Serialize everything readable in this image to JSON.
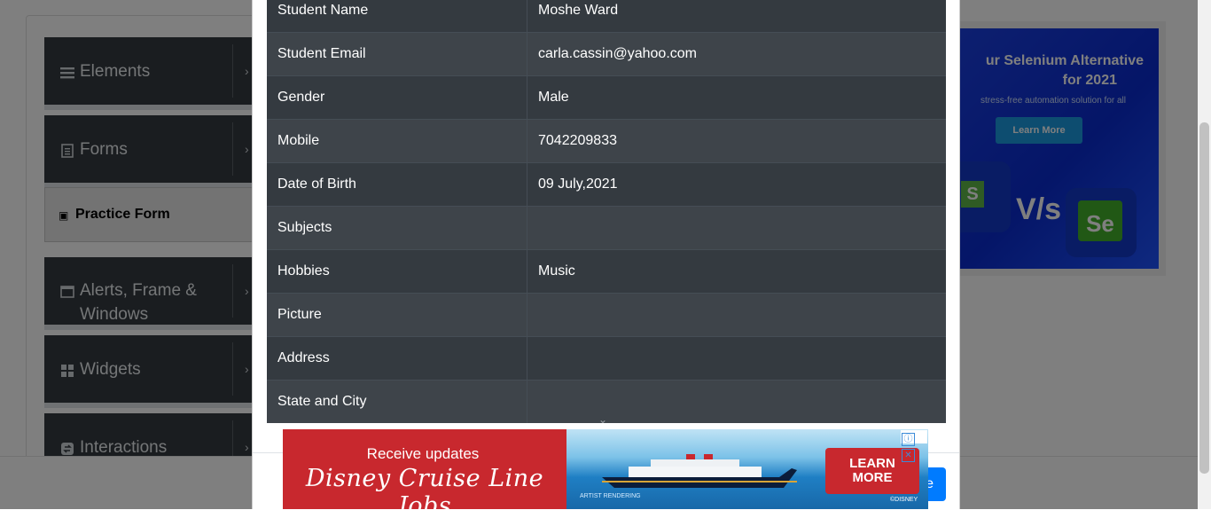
{
  "sidebar": {
    "groups": [
      {
        "label": "Elements",
        "icon": "hamburger-icon"
      },
      {
        "label": "Forms",
        "icon": "document-icon"
      },
      {
        "label": "Alerts, Frame &",
        "label2": "Windows",
        "icon": "window-icon"
      },
      {
        "label": "Widgets",
        "icon": "widgets-icon"
      },
      {
        "label": "Interactions",
        "icon": "interactions-icon"
      }
    ],
    "active_item": "Practice Form"
  },
  "ad_right": {
    "title_line1": "ur Selenium Alternative",
    "title_line2": "for 2021",
    "subtitle": "stress-free automation solution for all",
    "button": "Learn More",
    "vs": "V/s",
    "logo_left": "S",
    "logo_right": "Se"
  },
  "modal": {
    "rows": [
      {
        "label": "Student Name",
        "value": "Moshe Ward"
      },
      {
        "label": "Student Email",
        "value": "carla.cassin@yahoo.com"
      },
      {
        "label": "Gender",
        "value": "Male"
      },
      {
        "label": "Mobile",
        "value": "7042209833"
      },
      {
        "label": "Date of Birth",
        "value": "09 July,2021"
      },
      {
        "label": "Subjects",
        "value": ""
      },
      {
        "label": "Hobbies",
        "value": "Music"
      },
      {
        "label": "Picture",
        "value": ""
      },
      {
        "label": "Address",
        "value": ""
      },
      {
        "label": "State and City",
        "value": ""
      }
    ],
    "close_button": "e"
  },
  "ad_bottom": {
    "tagline": "Receive updates",
    "brand": "Disney Cruise Line Jobs",
    "art_note": "ARTIST RENDERING",
    "cta_line1": "LEARN",
    "cta_line2": "MORE",
    "copyright": "©DISNEY",
    "adchoices_icon": "ⓘ",
    "close_icon": "✕"
  },
  "colors": {
    "table_dark": "#343a40",
    "table_darker": "#3e444a",
    "primary": "#007bff",
    "ad_red": "#c8282e",
    "ad_blue": "#0a2bd0"
  }
}
